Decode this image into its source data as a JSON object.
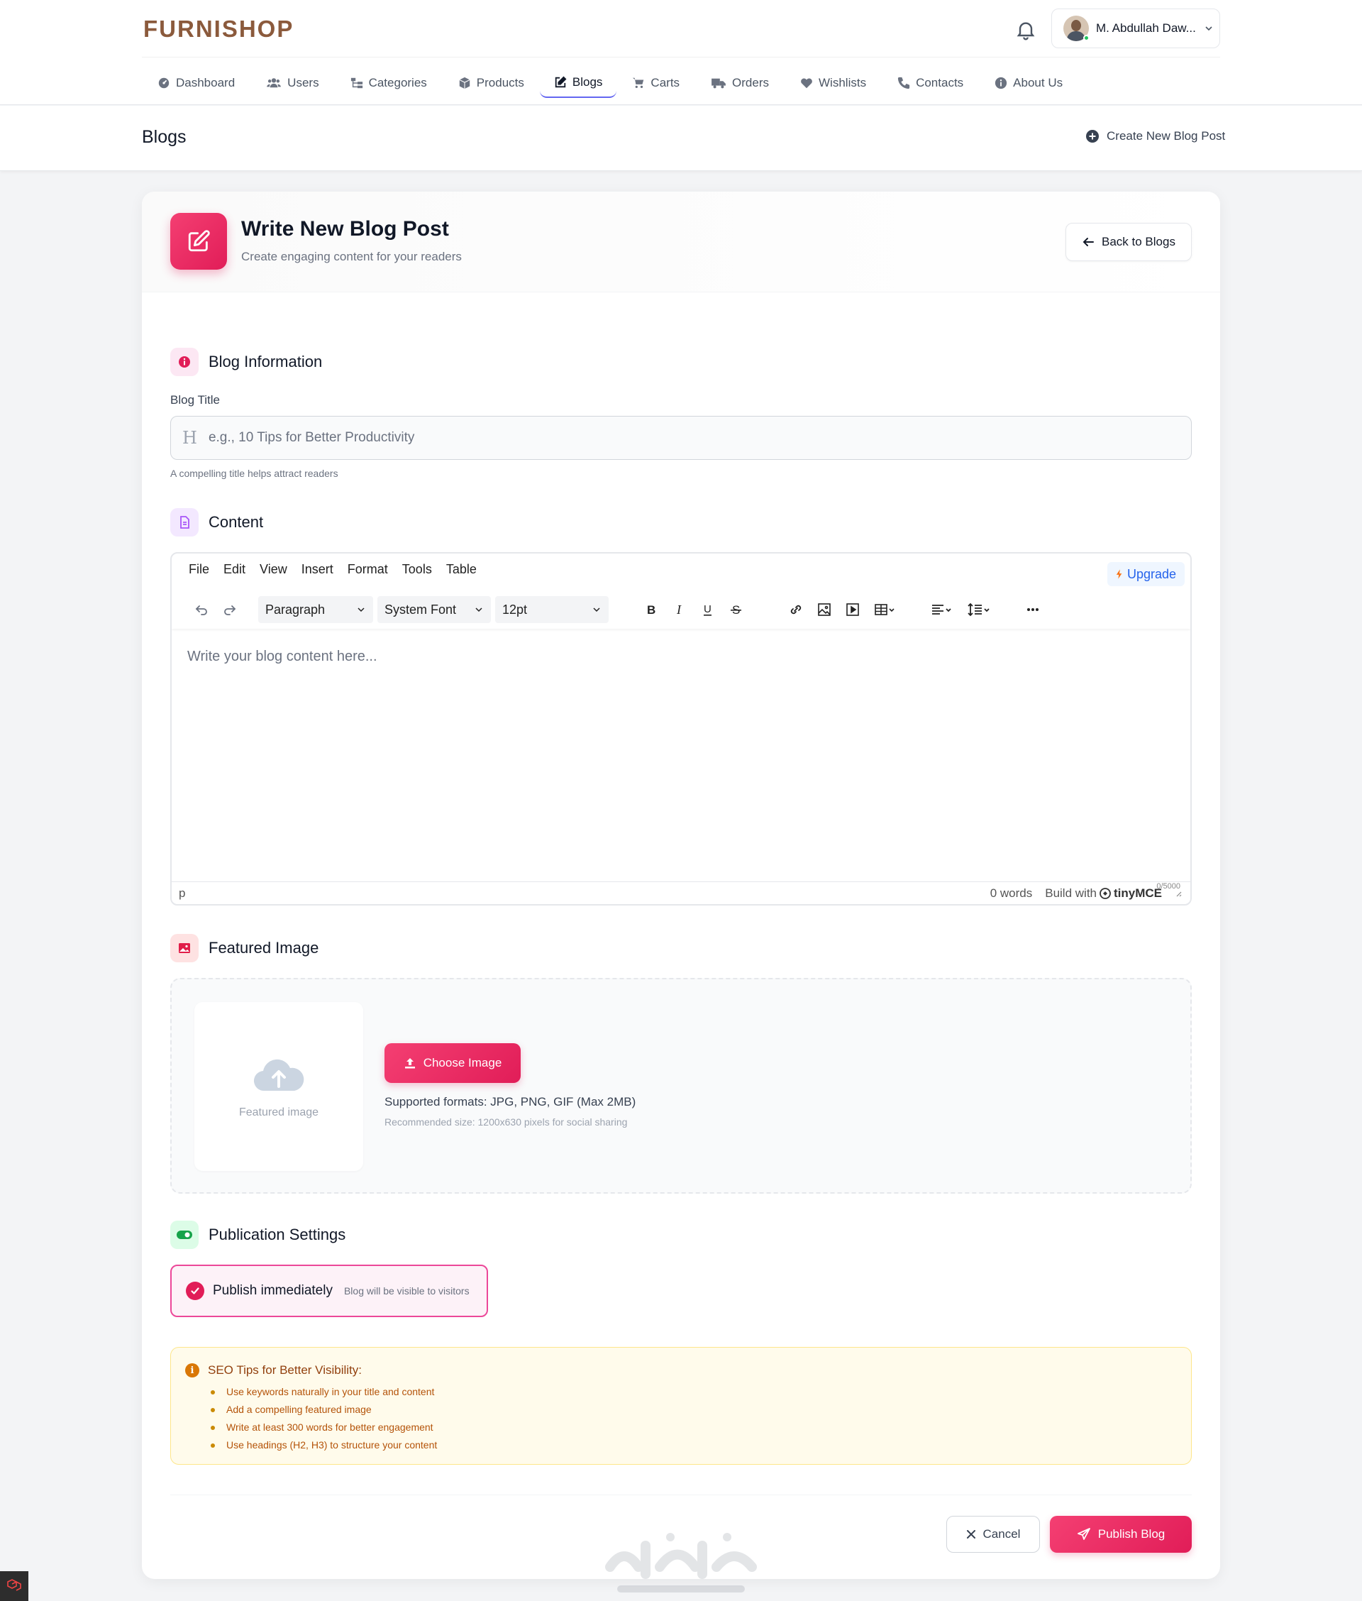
{
  "brand": {
    "logo_text": "FURNISHOP",
    "color": "#8b5a3c"
  },
  "user": {
    "name": "M. Abdullah Daw...",
    "status_color": "#22c55e"
  },
  "nav": {
    "items": [
      {
        "label": "Dashboard",
        "icon": "dashboard-icon"
      },
      {
        "label": "Users",
        "icon": "users-icon"
      },
      {
        "label": "Categories",
        "icon": "categories-icon"
      },
      {
        "label": "Products",
        "icon": "box-icon"
      },
      {
        "label": "Blogs",
        "icon": "edit-icon",
        "active": true
      },
      {
        "label": "Carts",
        "icon": "cart-icon"
      },
      {
        "label": "Orders",
        "icon": "truck-icon"
      },
      {
        "label": "Wishlists",
        "icon": "heart-icon"
      },
      {
        "label": "Contacts",
        "icon": "phone-icon"
      },
      {
        "label": "About Us",
        "icon": "info-icon"
      }
    ]
  },
  "subheader": {
    "title": "Blogs",
    "create_label": "Create New Blog Post"
  },
  "card": {
    "title": "Write New Blog Post",
    "subtitle": "Create engaging content for your readers",
    "back_label": "Back to Blogs"
  },
  "sections": {
    "info": "Blog Information",
    "content": "Content",
    "image": "Featured Image",
    "publication": "Publication Settings"
  },
  "title_field": {
    "label": "Blog Title",
    "placeholder": "e.g., 10 Tips for Better Productivity",
    "value": "",
    "hint": "A compelling title helps attract readers"
  },
  "editor": {
    "menu": [
      "File",
      "Edit",
      "View",
      "Insert",
      "Format",
      "Tools",
      "Table"
    ],
    "upgrade_label": "Upgrade",
    "block_format": "Paragraph",
    "font_family": "System Font",
    "font_size": "12pt",
    "placeholder": "Write your blog content here...",
    "path": "p",
    "word_count": "0 words",
    "build_with": "Build with",
    "brand": "tinyMCE",
    "char_counter": "0/5000"
  },
  "featured_image": {
    "preview_label": "Featured image",
    "button_label": "Choose Image",
    "formats": "Supported formats: JPG, PNG, GIF (Max 2MB)",
    "recommended": "Recommended size: 1200x630 pixels for social sharing"
  },
  "publication": {
    "label": "Publish immediately",
    "hint": "Blog will be visible to visitors",
    "checked": true
  },
  "seo": {
    "title": "SEO Tips for Better Visibility:",
    "tips": [
      "Use keywords naturally in your title and content",
      "Add a compelling featured image",
      "Write at least 300 words for better engagement",
      "Use headings (H2, H3) to structure your content"
    ]
  },
  "actions": {
    "cancel_label": "Cancel",
    "publish_label": "Publish Blog"
  },
  "colors": {
    "accent": "#e11d58",
    "nav_active": "#6366f1",
    "seo_bg": "#fffbeb"
  }
}
